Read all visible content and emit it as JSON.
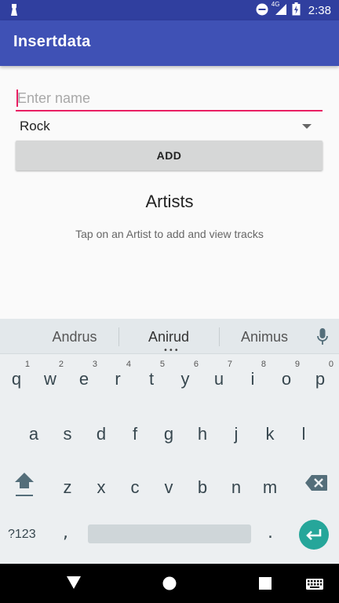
{
  "status_bar": {
    "time": "2:38",
    "network": "4G"
  },
  "app_bar": {
    "title": "Insertdata"
  },
  "form": {
    "name_placeholder": "Enter name",
    "name_value": "",
    "genre_selected": "Rock",
    "add_label": "ADD"
  },
  "list": {
    "title": "Artists",
    "hint": "Tap on an Artist to add and view tracks"
  },
  "keyboard": {
    "suggestions": [
      "Andrus",
      "Anirud",
      "Animus"
    ],
    "row1": [
      {
        "key": "q",
        "num": "1"
      },
      {
        "key": "w",
        "num": "2"
      },
      {
        "key": "e",
        "num": "3"
      },
      {
        "key": "r",
        "num": "4"
      },
      {
        "key": "t",
        "num": "5"
      },
      {
        "key": "y",
        "num": "6"
      },
      {
        "key": "u",
        "num": "7"
      },
      {
        "key": "i",
        "num": "8"
      },
      {
        "key": "o",
        "num": "9"
      },
      {
        "key": "p",
        "num": "0"
      }
    ],
    "row2": [
      "a",
      "s",
      "d",
      "f",
      "g",
      "h",
      "j",
      "k",
      "l"
    ],
    "row3": [
      "z",
      "x",
      "c",
      "v",
      "b",
      "n",
      "m"
    ],
    "symbols_label": "?123",
    "comma": ",",
    "period": "."
  },
  "colors": {
    "primary": "#3f51b5",
    "primary_dark": "#303f9f",
    "accent": "#e91e63",
    "enter": "#26a69a"
  }
}
